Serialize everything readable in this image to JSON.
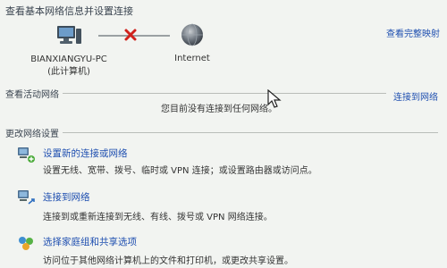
{
  "header": {
    "title": "查看基本网络信息并设置连接",
    "full_map_link": "查看完整映射"
  },
  "map": {
    "computer_name": "BIANXIANGYU-PC",
    "computer_sub": "(此计算机)",
    "internet_label": "Internet"
  },
  "active": {
    "label": "查看活动网络",
    "empty_text": "您目前没有连接到任何网络。",
    "connect_link": "连接到网络"
  },
  "change": {
    "label": "更改网络设置",
    "tasks": [
      {
        "title": "设置新的连接或网络",
        "desc": "设置无线、宽带、拨号、临时或 VPN 连接；或设置路由器或访问点。"
      },
      {
        "title": "连接到网络",
        "desc": "连接到或重新连接到无线、有线、拨号或 VPN 网络连接。"
      },
      {
        "title": "选择家庭组和共享选项",
        "desc": "访问位于其他网络计算机上的文件和打印机，或更改共享设置。"
      }
    ]
  },
  "colors": {
    "link": "#1f4fb0",
    "error": "#d0211c",
    "background": "#f2f4f1"
  }
}
